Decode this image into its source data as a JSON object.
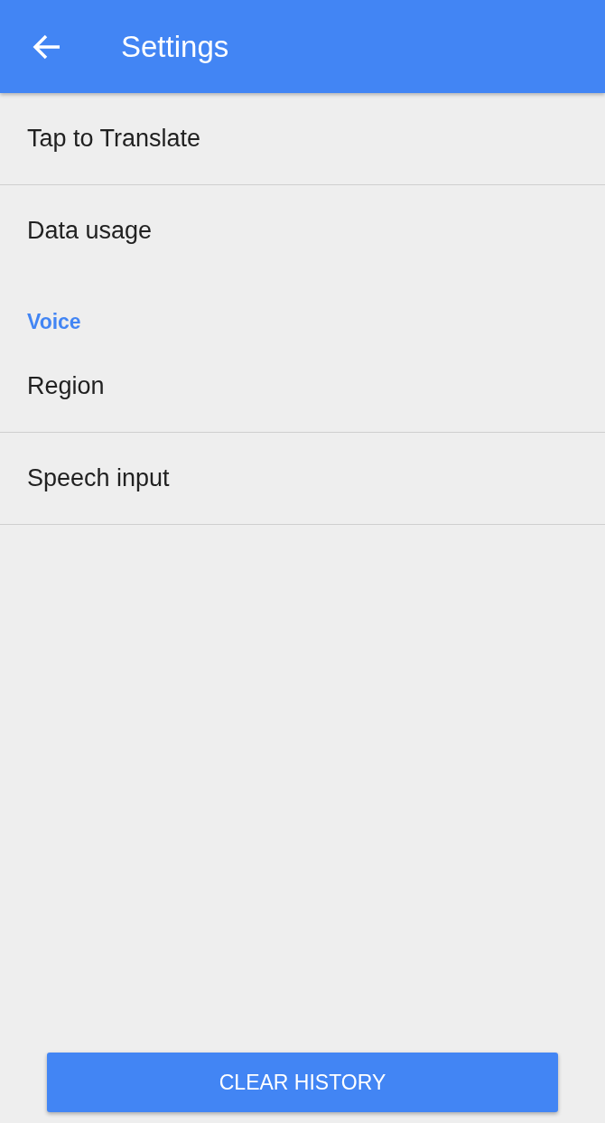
{
  "app_bar": {
    "title": "Settings"
  },
  "items": [
    {
      "kind": "item",
      "label": "Tap to Translate",
      "divider": true
    },
    {
      "kind": "item",
      "label": "Data usage",
      "divider": false
    },
    {
      "kind": "header",
      "label": "Voice",
      "divider": false
    },
    {
      "kind": "item",
      "label": "Region",
      "divider": true
    },
    {
      "kind": "item",
      "label": "Speech input",
      "divider": true
    }
  ],
  "button": {
    "label": "CLEAR HISTORY"
  }
}
